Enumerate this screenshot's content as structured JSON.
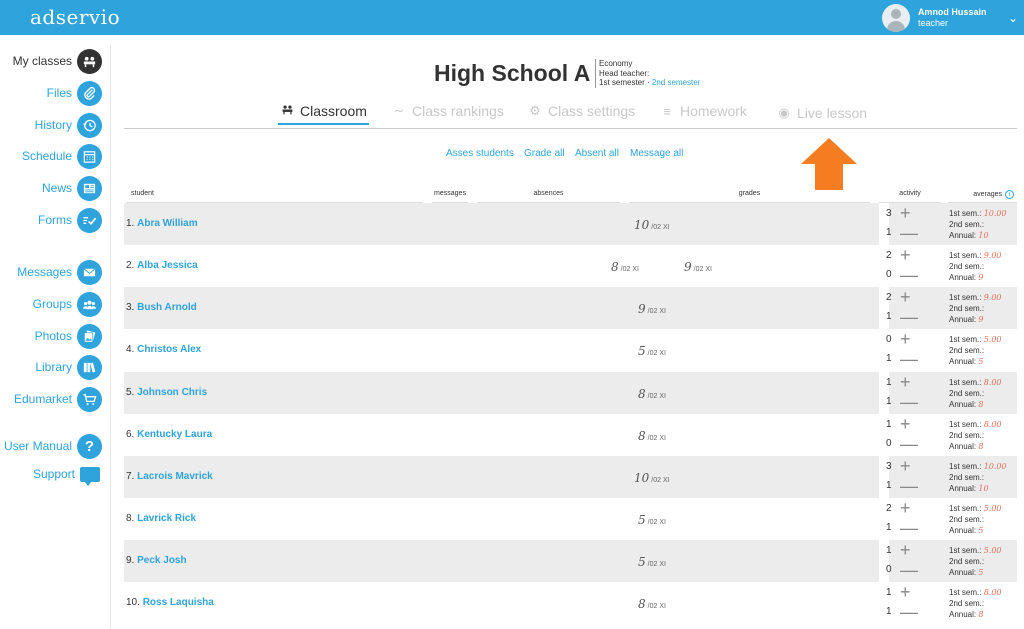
{
  "app": {
    "logo": "adservio"
  },
  "user": {
    "name": "Amnod Hussain",
    "role": "teacher"
  },
  "sidebar": {
    "items": [
      {
        "label": "My classes",
        "icon": "classroom-icon",
        "active": true
      },
      {
        "label": "Files",
        "icon": "paperclip-icon"
      },
      {
        "label": "History",
        "icon": "history-icon"
      },
      {
        "label": "Schedule",
        "icon": "calendar-icon"
      },
      {
        "label": "News",
        "icon": "news-icon"
      },
      {
        "label": "Forms",
        "icon": "forms-icon"
      },
      {
        "label": "Messages",
        "icon": "envelope-icon"
      },
      {
        "label": "Groups",
        "icon": "groups-icon"
      },
      {
        "label": "Photos",
        "icon": "photos-icon"
      },
      {
        "label": "Library",
        "icon": "library-icon"
      },
      {
        "label": "Edumarket",
        "icon": "cart-icon"
      },
      {
        "label": "User Manual",
        "icon": "help-icon"
      },
      {
        "label": "Support",
        "icon": "chat-icon"
      }
    ]
  },
  "header": {
    "school": "High School A",
    "subject": "Economy",
    "head_teacher": "Head teacher:",
    "semester1": "1st semester",
    "semester_sep": " · ",
    "semester2": "2nd semester"
  },
  "tabs": [
    {
      "label": "Classroom",
      "icon": "classroom-icon",
      "active": true
    },
    {
      "label": "Class rankings",
      "icon": "chart-icon"
    },
    {
      "label": "Class settings",
      "icon": "gear-icon"
    },
    {
      "label": "Homework",
      "icon": "homework-icon"
    },
    {
      "label": "Live lesson",
      "icon": "live-lesson-icon"
    }
  ],
  "actions": [
    "Asses students",
    "Grade all",
    "Absent all",
    "Message all"
  ],
  "columns": {
    "student": "student",
    "messages": "messages",
    "absences": "absences",
    "grades": "grades",
    "activity": "activity",
    "averages": "averages"
  },
  "avg_labels": {
    "sem1": "1st sem.:",
    "sem2": "2nd sem.:",
    "annual": "Annual:"
  },
  "accent_color": "#2ea3dc",
  "arrow_color": "#f47d22",
  "students": [
    {
      "num": "1.",
      "name": "Abra William",
      "grades": [
        {
          "value": "10",
          "date": "/02 XI"
        }
      ],
      "act_plus": "3",
      "act_minus": "1",
      "sem1": "10.00",
      "sem2": "",
      "annual": "10"
    },
    {
      "num": "2.",
      "name": "Alba Jessica",
      "grades": [
        {
          "value": "8",
          "date": "/02 XI"
        },
        {
          "value": "9",
          "date": "/02 XI"
        }
      ],
      "act_plus": "2",
      "act_minus": "0",
      "sem1": "9.00",
      "sem2": "",
      "annual": "9"
    },
    {
      "num": "3.",
      "name": "Bush Arnold",
      "grades": [
        {
          "value": "9",
          "date": "/02 XI"
        }
      ],
      "act_plus": "2",
      "act_minus": "1",
      "sem1": "9.00",
      "sem2": "",
      "annual": "9"
    },
    {
      "num": "4.",
      "name": "Christos Alex",
      "grades": [
        {
          "value": "5",
          "date": "/02 XI"
        }
      ],
      "act_plus": "0",
      "act_minus": "1",
      "sem1": "5.00",
      "sem2": "",
      "annual": "5"
    },
    {
      "num": "5.",
      "name": "Johnson Chris",
      "grades": [
        {
          "value": "8",
          "date": "/02 XI"
        }
      ],
      "act_plus": "1",
      "act_minus": "1",
      "sem1": "8.00",
      "sem2": "",
      "annual": "8"
    },
    {
      "num": "6.",
      "name": "Kentucky Laura",
      "grades": [
        {
          "value": "8",
          "date": "/02 XI"
        }
      ],
      "act_plus": "1",
      "act_minus": "0",
      "sem1": "8.00",
      "sem2": "",
      "annual": "8"
    },
    {
      "num": "7.",
      "name": "Lacrois Mavrick",
      "grades": [
        {
          "value": "10",
          "date": "/02 XI"
        }
      ],
      "act_plus": "3",
      "act_minus": "1",
      "sem1": "10.00",
      "sem2": "",
      "annual": "10"
    },
    {
      "num": "8.",
      "name": "Lavrick Rick",
      "grades": [
        {
          "value": "5",
          "date": "/02 XI"
        }
      ],
      "act_plus": "2",
      "act_minus": "1",
      "sem1": "5.00",
      "sem2": "",
      "annual": "5"
    },
    {
      "num": "9.",
      "name": "Peck Josh",
      "grades": [
        {
          "value": "5",
          "date": "/02 XI"
        }
      ],
      "act_plus": "1",
      "act_minus": "0",
      "sem1": "5.00",
      "sem2": "",
      "annual": "5"
    },
    {
      "num": "10.",
      "name": "Ross Laquisha",
      "grades": [
        {
          "value": "8",
          "date": "/02 XI"
        }
      ],
      "act_plus": "1",
      "act_minus": "1",
      "sem1": "8.00",
      "sem2": "",
      "annual": "8"
    }
  ]
}
